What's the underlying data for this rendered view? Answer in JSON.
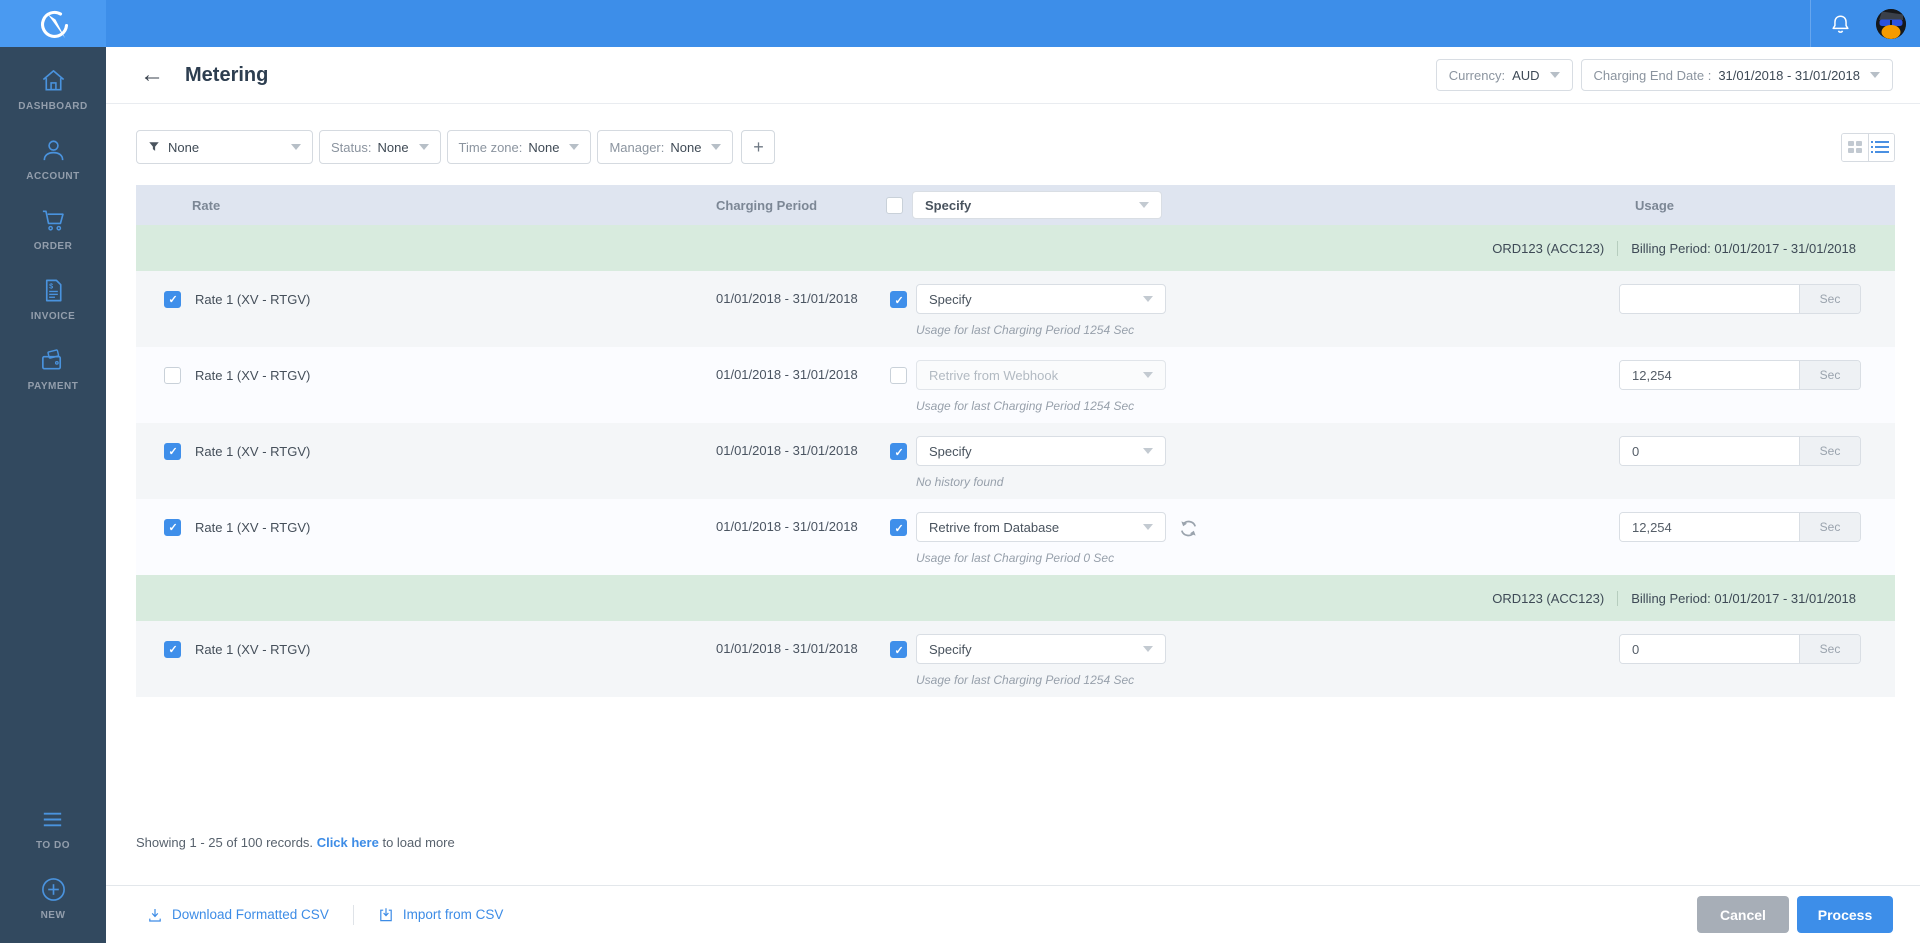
{
  "topbar": {
    "accent": "#3d8ee9"
  },
  "sidebar": {
    "items": [
      {
        "label": "DASHBOARD",
        "icon": "home-icon"
      },
      {
        "label": "ACCOUNT",
        "icon": "person-icon"
      },
      {
        "label": "ORDER",
        "icon": "cart-icon"
      },
      {
        "label": "INVOICE",
        "icon": "invoice-icon"
      },
      {
        "label": "PAYMENT",
        "icon": "wallet-icon"
      }
    ],
    "bottom_items": [
      {
        "label": "TO DO",
        "icon": "todo-list-icon"
      },
      {
        "label": "NEW",
        "icon": "plus-circle-icon"
      }
    ]
  },
  "header": {
    "title": "Metering",
    "currency_label": "Currency:",
    "currency_value": "AUD",
    "charging_label": "Charging End Date :",
    "charging_value": "31/01/2018 - 31/01/2018"
  },
  "filters": {
    "primary_value": "None",
    "status_label": "Status:",
    "status_value": "None",
    "timezone_label": "Time zone:",
    "timezone_value": "None",
    "manager_label": "Manager:",
    "manager_value": "None",
    "add_label": "+"
  },
  "table": {
    "units_label": "Sec",
    "headers": {
      "rate": "Rate",
      "charging_period": "Charging Period",
      "specify": "Specify",
      "usage": "Usage",
      "specify_checked": false
    },
    "groups": [
      {
        "order": "ORD123 (ACC123)",
        "billing": "Billing Period: 01/01/2017 - 31/01/2018",
        "rows": [
          {
            "selected": true,
            "rate": "Rate 1 (XV - RTGV)",
            "period": "01/01/2018 - 31/01/2018",
            "method_checked": true,
            "method": "Specify",
            "method_disabled": false,
            "refresh": false,
            "helper": "Usage for last Charging Period 1254 Sec",
            "usage": ""
          },
          {
            "selected": false,
            "rate": "Rate 1 (XV - RTGV)",
            "period": "01/01/2018 - 31/01/2018",
            "method_checked": false,
            "method": "Retrive from Webhook",
            "method_disabled": true,
            "refresh": false,
            "helper": "Usage for last Charging Period 1254 Sec",
            "usage": "12,254"
          },
          {
            "selected": true,
            "rate": "Rate 1 (XV - RTGV)",
            "period": "01/01/2018 - 31/01/2018",
            "method_checked": true,
            "method": "Specify",
            "method_disabled": false,
            "refresh": false,
            "helper": "No history found",
            "usage": "0"
          },
          {
            "selected": true,
            "rate": "Rate 1 (XV - RTGV)",
            "period": "01/01/2018 - 31/01/2018",
            "method_checked": true,
            "method": "Retrive from Database",
            "method_disabled": false,
            "refresh": true,
            "helper": "Usage for last Charging Period 0 Sec",
            "usage": "12,254"
          }
        ]
      },
      {
        "order": "ORD123 (ACC123)",
        "billing": "Billing Period: 01/01/2017 - 31/01/2018",
        "rows": [
          {
            "selected": true,
            "rate": "Rate 1 (XV - RTGV)",
            "period": "01/01/2018 - 31/01/2018",
            "method_checked": true,
            "method": "Specify",
            "method_disabled": false,
            "refresh": false,
            "helper": "Usage for last Charging Period 1254 Sec",
            "usage": "0"
          }
        ]
      }
    ]
  },
  "footer": {
    "showing_prefix": "Showing 1 - 25 of 100 records.",
    "link_label": "Click here",
    "suffix": "to load more"
  },
  "actions": {
    "download": "Download Formatted CSV",
    "import": "Import from CSV",
    "cancel": "Cancel",
    "process": "Process"
  }
}
